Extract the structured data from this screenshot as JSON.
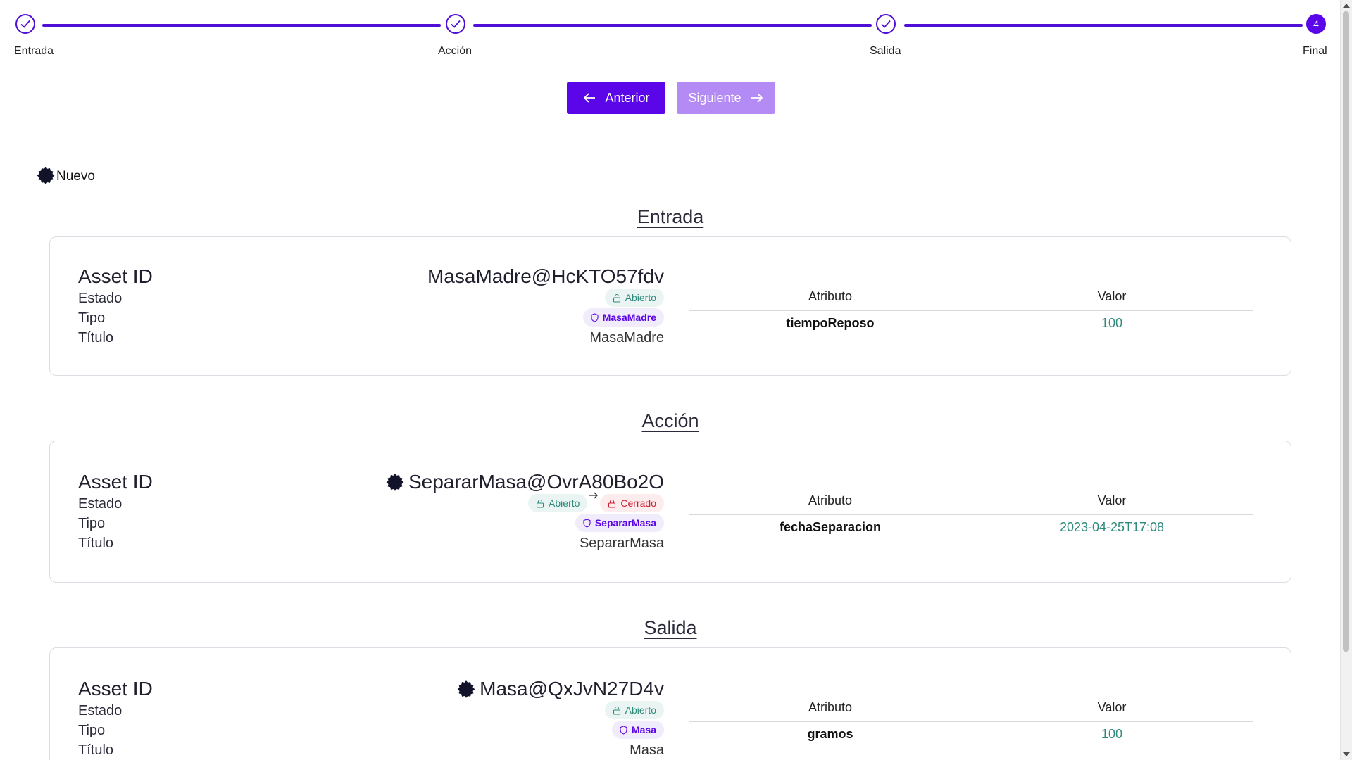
{
  "stepper": {
    "steps": [
      {
        "label": "Entrada",
        "state": "done"
      },
      {
        "label": "Acción",
        "state": "done"
      },
      {
        "label": "Salida",
        "state": "done"
      },
      {
        "label": "Final",
        "state": "current",
        "number": "4"
      }
    ]
  },
  "nav": {
    "prev_label": "Anterior",
    "next_label": "Siguiente"
  },
  "badge": {
    "label": "Nuevo"
  },
  "colors": {
    "accent": "#5b06e8",
    "accent_light": "#b48af5",
    "open": "#2e8a7a",
    "closed": "#cc2233"
  },
  "table_headers": {
    "attribute": "Atributo",
    "value": "Valor"
  },
  "labels": {
    "asset_id": "Asset ID",
    "estado": "Estado",
    "tipo": "Tipo",
    "titulo": "Título"
  },
  "sections": [
    {
      "title": "Entrada",
      "asset_id": "MasaMadre@HcKTO57fdv",
      "estado": "Abierto",
      "tipo": "MasaMadre",
      "titulo": "MasaMadre",
      "attributes": [
        {
          "name": "tiempoReposo",
          "value": "100"
        }
      ]
    },
    {
      "title": "Acción",
      "asset_id": "SepararMasa@OvrA80Bo2O",
      "estado_from": "Abierto",
      "estado_to": "Cerrado",
      "tipo": "SepararMasa",
      "titulo": "SepararMasa",
      "attributes": [
        {
          "name": "fechaSeparacion",
          "value": "2023-04-25T17:08"
        }
      ]
    },
    {
      "title": "Salida",
      "asset_id": "Masa@QxJvN27D4v",
      "estado": "Abierto",
      "tipo": "Masa",
      "titulo": "Masa",
      "attributes": [
        {
          "name": "gramos",
          "value": "100"
        }
      ]
    }
  ]
}
